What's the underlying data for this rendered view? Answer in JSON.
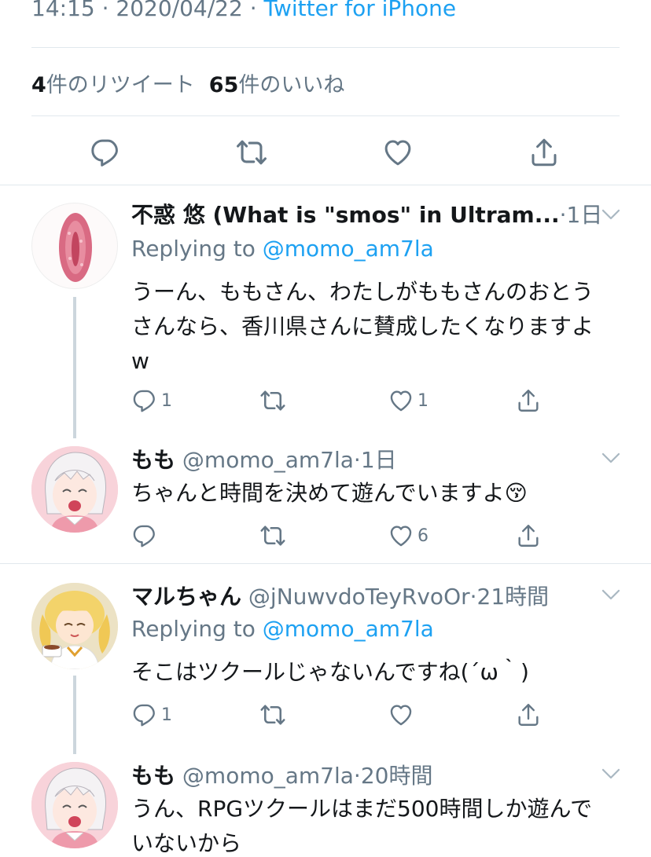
{
  "header": {
    "time": "14:15",
    "date": "2020/04/22",
    "source": "Twitter for iPhone",
    "separator": " · "
  },
  "stats": {
    "retweets_count": "4",
    "retweets_label": "件のリツイート",
    "likes_count": "65",
    "likes_label": "件のいいね"
  },
  "icons": {
    "reply": "reply-icon",
    "retweet": "retweet-icon",
    "like": "heart-icon",
    "share": "share-icon",
    "menu": "chevron-down-icon"
  },
  "colors": {
    "link": "#1da1f2",
    "secondary": "#657786",
    "divider": "#e1e8ed",
    "thread": "#ccd6dd"
  },
  "replies": [
    {
      "name": "不惑 悠 (What is \"smos\" in Ultram...",
      "handle": "",
      "time": "·1日",
      "replying_label": "Replying to",
      "replying_to": "@momo_am7la",
      "text": "うーん、ももさん、わたしがももさんのおとうさんなら、香川県さんに賛成したくなりますよw",
      "reply_count": "1",
      "retweet_count": "",
      "like_count": "1"
    },
    {
      "name": "もも",
      "handle": "@momo_am7la",
      "time": "·1日",
      "text": "ちゃんと時間を決めて遊んでいますよ😚",
      "reply_count": "",
      "retweet_count": "",
      "like_count": "6"
    },
    {
      "name": "マルちゃん",
      "handle": "@jNuwvdoTeyRvoOr",
      "time": "·21時間",
      "replying_label": "Replying to",
      "replying_to": "@momo_am7la",
      "text": "そこはツクールじゃないんですね(´ω｀)",
      "reply_count": "1",
      "retweet_count": "",
      "like_count": ""
    },
    {
      "name": "もも",
      "handle": "@momo_am7la",
      "time": "·20時間",
      "text": "うん、RPGツクールはまだ500時間しか遊んでいないから"
    }
  ]
}
